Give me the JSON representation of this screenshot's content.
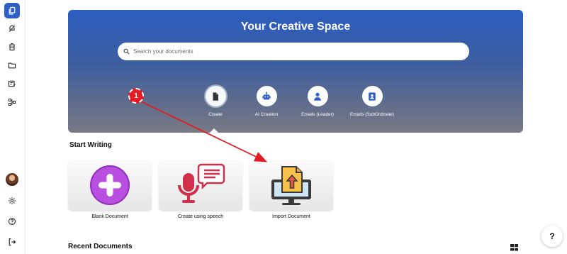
{
  "hero": {
    "title": "Your Creative Space",
    "search_placeholder": "Search your documents",
    "actions": [
      {
        "label": "Create",
        "icon": "file-icon"
      },
      {
        "label": "AI Creation",
        "icon": "robot-icon"
      },
      {
        "label": "Emails (Leader)",
        "icon": "user-badge-icon"
      },
      {
        "label": "Emails (SubOrdinate)",
        "icon": "contact-card-icon"
      }
    ]
  },
  "start_writing": {
    "title": "Start Writing",
    "cards": [
      {
        "label": "Blank Document",
        "icon": "plus-circle-icon"
      },
      {
        "label": "Create using speech",
        "icon": "microphone-icon"
      },
      {
        "label": "Import Document",
        "icon": "import-monitor-icon"
      }
    ]
  },
  "recent": {
    "title": "Recent Documents"
  },
  "help": {
    "label": "?"
  },
  "annotation": {
    "step": "1"
  },
  "colors": {
    "accent": "#2f5fc4",
    "annotation": "#e31b23",
    "plus": "#b84fe0",
    "mic": "#d0304c"
  }
}
